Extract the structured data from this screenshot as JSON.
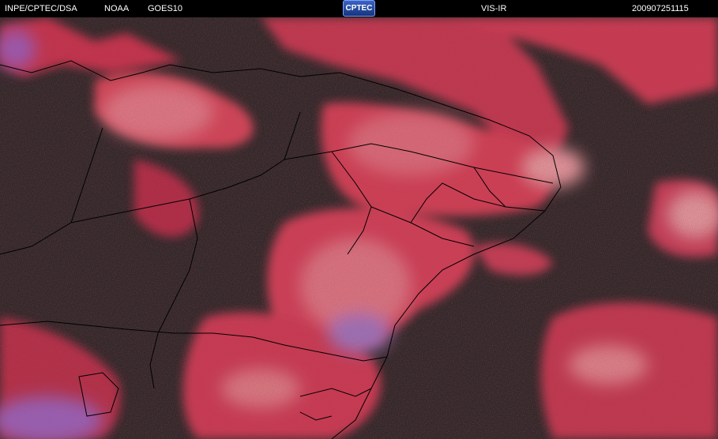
{
  "header": {
    "source": "INPE/CPTEC/DSA",
    "agency": "NOAA",
    "satellite": "GOES10",
    "logo_text": "CPTEC",
    "channel": "VIS-IR",
    "timestamp": "200907251115"
  },
  "image": {
    "type": "satellite composite",
    "background_color": "#2a2a2a",
    "cloud_color": "#d83b55",
    "bright_cloud_color": "#e58a92",
    "high_cloud_color": "#8a5fb8",
    "border_color": "#000000"
  }
}
